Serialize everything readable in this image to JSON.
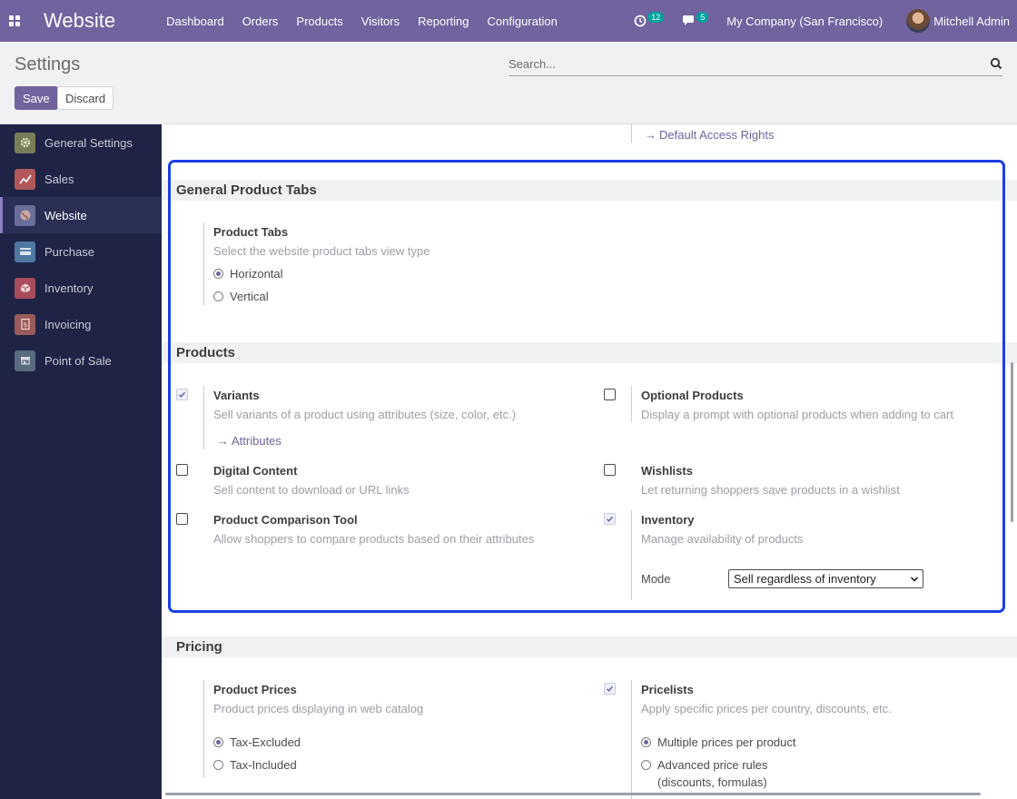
{
  "navbar": {
    "brand": "Website",
    "menu": [
      "Dashboard",
      "Orders",
      "Products",
      "Visitors",
      "Reporting",
      "Configuration"
    ],
    "activities_count": "12",
    "messages_count": "5",
    "company": "My Company (San Francisco)",
    "user": "Mitchell Admin"
  },
  "control": {
    "title": "Settings",
    "save": "Save",
    "discard": "Discard",
    "search_placeholder": "Search..."
  },
  "sidebar": {
    "items": [
      {
        "label": "General Settings",
        "color": "#7a7d5a"
      },
      {
        "label": "Sales",
        "color": "#b2585a"
      },
      {
        "label": "Website",
        "color": "#6b6d9b"
      },
      {
        "label": "Purchase",
        "color": "#4f78a3"
      },
      {
        "label": "Inventory",
        "color": "#a84c5e"
      },
      {
        "label": "Invoicing",
        "color": "#9b5a5a"
      },
      {
        "label": "Point of Sale",
        "color": "#5a6a80"
      }
    ],
    "active_index": 2
  },
  "main": {
    "top_link": "Default Access Rights",
    "tabs_section": {
      "heading": "General Product Tabs",
      "title": "Product Tabs",
      "desc": "Select the website product tabs view type",
      "options": [
        "Horizontal",
        "Vertical"
      ],
      "selected": 0
    },
    "products_section": {
      "heading": "Products",
      "variants": {
        "title": "Variants",
        "desc": "Sell variants of a product using attributes (size, color, etc.)",
        "link": "Attributes",
        "checked": true
      },
      "optional": {
        "title": "Optional Products",
        "desc": "Display a prompt with optional products when adding to cart",
        "checked": false
      },
      "digital": {
        "title": "Digital Content",
        "desc": "Sell content to download or URL links",
        "checked": false
      },
      "wishlists": {
        "title": "Wishlists",
        "desc": "Let returning shoppers save products in a wishlist",
        "checked": false
      },
      "comparison": {
        "title": "Product Comparison Tool",
        "desc": "Allow shoppers to compare products based on their attributes",
        "checked": false
      },
      "inventory": {
        "title": "Inventory",
        "desc": "Manage availability of products",
        "mode_label": "Mode",
        "mode_value": "Sell regardless of inventory",
        "checked": true
      }
    },
    "pricing_section": {
      "heading": "Pricing",
      "prices": {
        "title": "Product Prices",
        "desc": "Product prices displaying in web catalog",
        "options": [
          "Tax-Excluded",
          "Tax-Included"
        ],
        "selected": 0
      },
      "pricelists": {
        "title": "Pricelists",
        "desc": "Apply specific prices per country, discounts, etc.",
        "options": [
          "Multiple prices per product",
          "Advanced price rules",
          "(discounts, formulas)"
        ],
        "selected": 0,
        "checked": true
      }
    }
  },
  "colors": {
    "accent": "#71639e",
    "sidebar_bg": "#1f2446",
    "highlight": "#1a3ee6"
  }
}
